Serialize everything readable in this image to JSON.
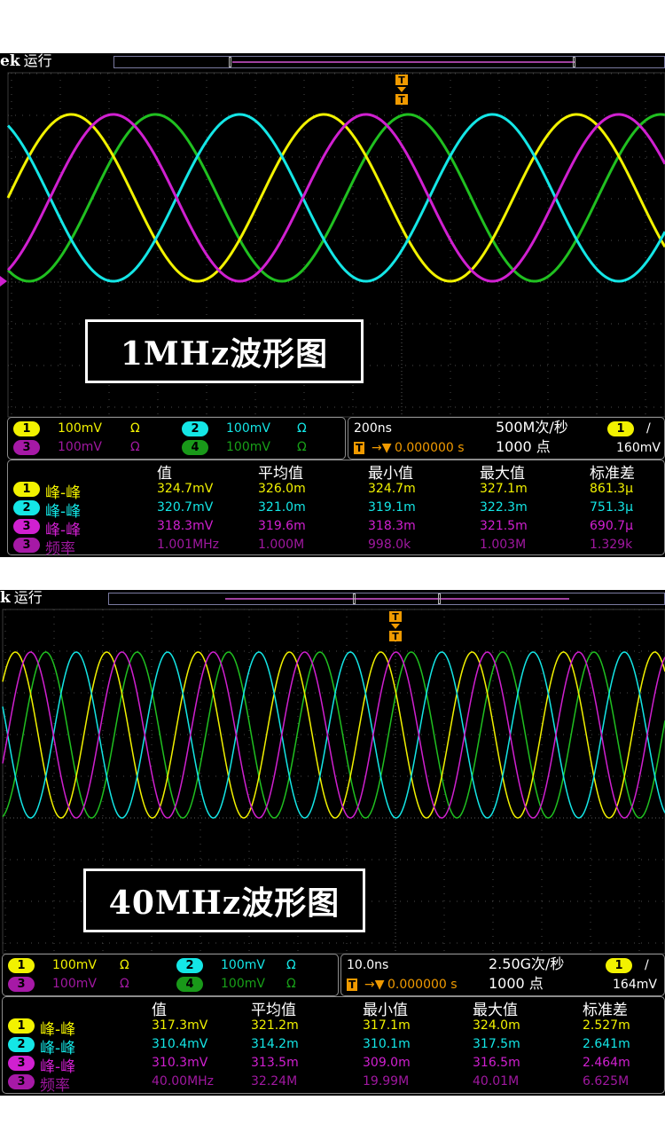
{
  "screens": [
    {
      "brand": "ek",
      "run_status": "运行",
      "trigger_marker": "T",
      "waveform_caption": "1MHz波形图",
      "waves_per_screen": 2.6,
      "channels": [
        {
          "id": "1",
          "scale": "100mV",
          "coupling": "Ω",
          "color": "#f2f200"
        },
        {
          "id": "2",
          "scale": "100mV",
          "coupling": "Ω",
          "color": "#14e6e6"
        },
        {
          "id": "3",
          "scale": "100mV",
          "coupling": "Ω",
          "color": "#d020d0"
        },
        {
          "id": "4",
          "scale": "100mV",
          "coupling": "Ω",
          "color": "#20c020"
        }
      ],
      "horizontal": {
        "time_div": "200ns",
        "sample_rate": "500M次/秒",
        "record_length": "1000 点",
        "trigger_position": "0.000000 s",
        "trigger_level": "160mV",
        "trigger_channel": "1",
        "trigger_slope": "/"
      },
      "measurement_headers": [
        "值",
        "平均值",
        "最小值",
        "最大值",
        "标准差"
      ],
      "measurements": [
        {
          "channel": "1",
          "name": "峰-峰",
          "value": "324.7mV",
          "mean": "326.0m",
          "min": "324.7m",
          "max": "327.1m",
          "std": "861.3μ"
        },
        {
          "channel": "2",
          "name": "峰-峰",
          "value": "320.7mV",
          "mean": "321.0m",
          "min": "319.1m",
          "max": "322.3m",
          "std": "751.3μ"
        },
        {
          "channel": "3",
          "name": "峰-峰",
          "value": "318.3mV",
          "mean": "319.6m",
          "min": "318.3m",
          "max": "321.5m",
          "std": "690.7μ"
        },
        {
          "channel": "3",
          "name": "频率",
          "value": "1.001MHz",
          "mean": "1.000M",
          "min": "998.0k",
          "max": "1.003M",
          "std": "1.329k"
        }
      ]
    },
    {
      "brand": "k",
      "run_status": "运行",
      "trigger_marker": "T",
      "waveform_caption": "40MHz波形图",
      "waves_per_screen": 7.25,
      "channels": [
        {
          "id": "1",
          "scale": "100mV",
          "coupling": "Ω",
          "color": "#f2f200"
        },
        {
          "id": "2",
          "scale": "100mV",
          "coupling": "Ω",
          "color": "#14e6e6"
        },
        {
          "id": "3",
          "scale": "100mV",
          "coupling": "Ω",
          "color": "#d020d0"
        },
        {
          "id": "4",
          "scale": "100mV",
          "coupling": "Ω",
          "color": "#20c020"
        }
      ],
      "horizontal": {
        "time_div": "10.0ns",
        "sample_rate": "2.50G次/秒",
        "record_length": "1000 点",
        "trigger_position": "0.000000 s",
        "trigger_level": "164mV",
        "trigger_channel": "1",
        "trigger_slope": "/"
      },
      "measurement_headers": [
        "值",
        "平均值",
        "最小值",
        "最大值",
        "标准差"
      ],
      "measurements": [
        {
          "channel": "1",
          "name": "峰-峰",
          "value": "317.3mV",
          "mean": "321.2m",
          "min": "317.1m",
          "max": "324.0m",
          "std": "2.527m"
        },
        {
          "channel": "2",
          "name": "峰-峰",
          "value": "310.4mV",
          "mean": "314.2m",
          "min": "310.1m",
          "max": "317.5m",
          "std": "2.641m"
        },
        {
          "channel": "3",
          "name": "峰-峰",
          "value": "310.3mV",
          "mean": "313.5m",
          "min": "309.0m",
          "max": "316.5m",
          "std": "2.464m"
        },
        {
          "channel": "3",
          "name": "频率",
          "value": "40.00MHz",
          "mean": "32.24M",
          "min": "19.99M",
          "max": "40.01M",
          "std": "6.625M"
        }
      ]
    }
  ]
}
